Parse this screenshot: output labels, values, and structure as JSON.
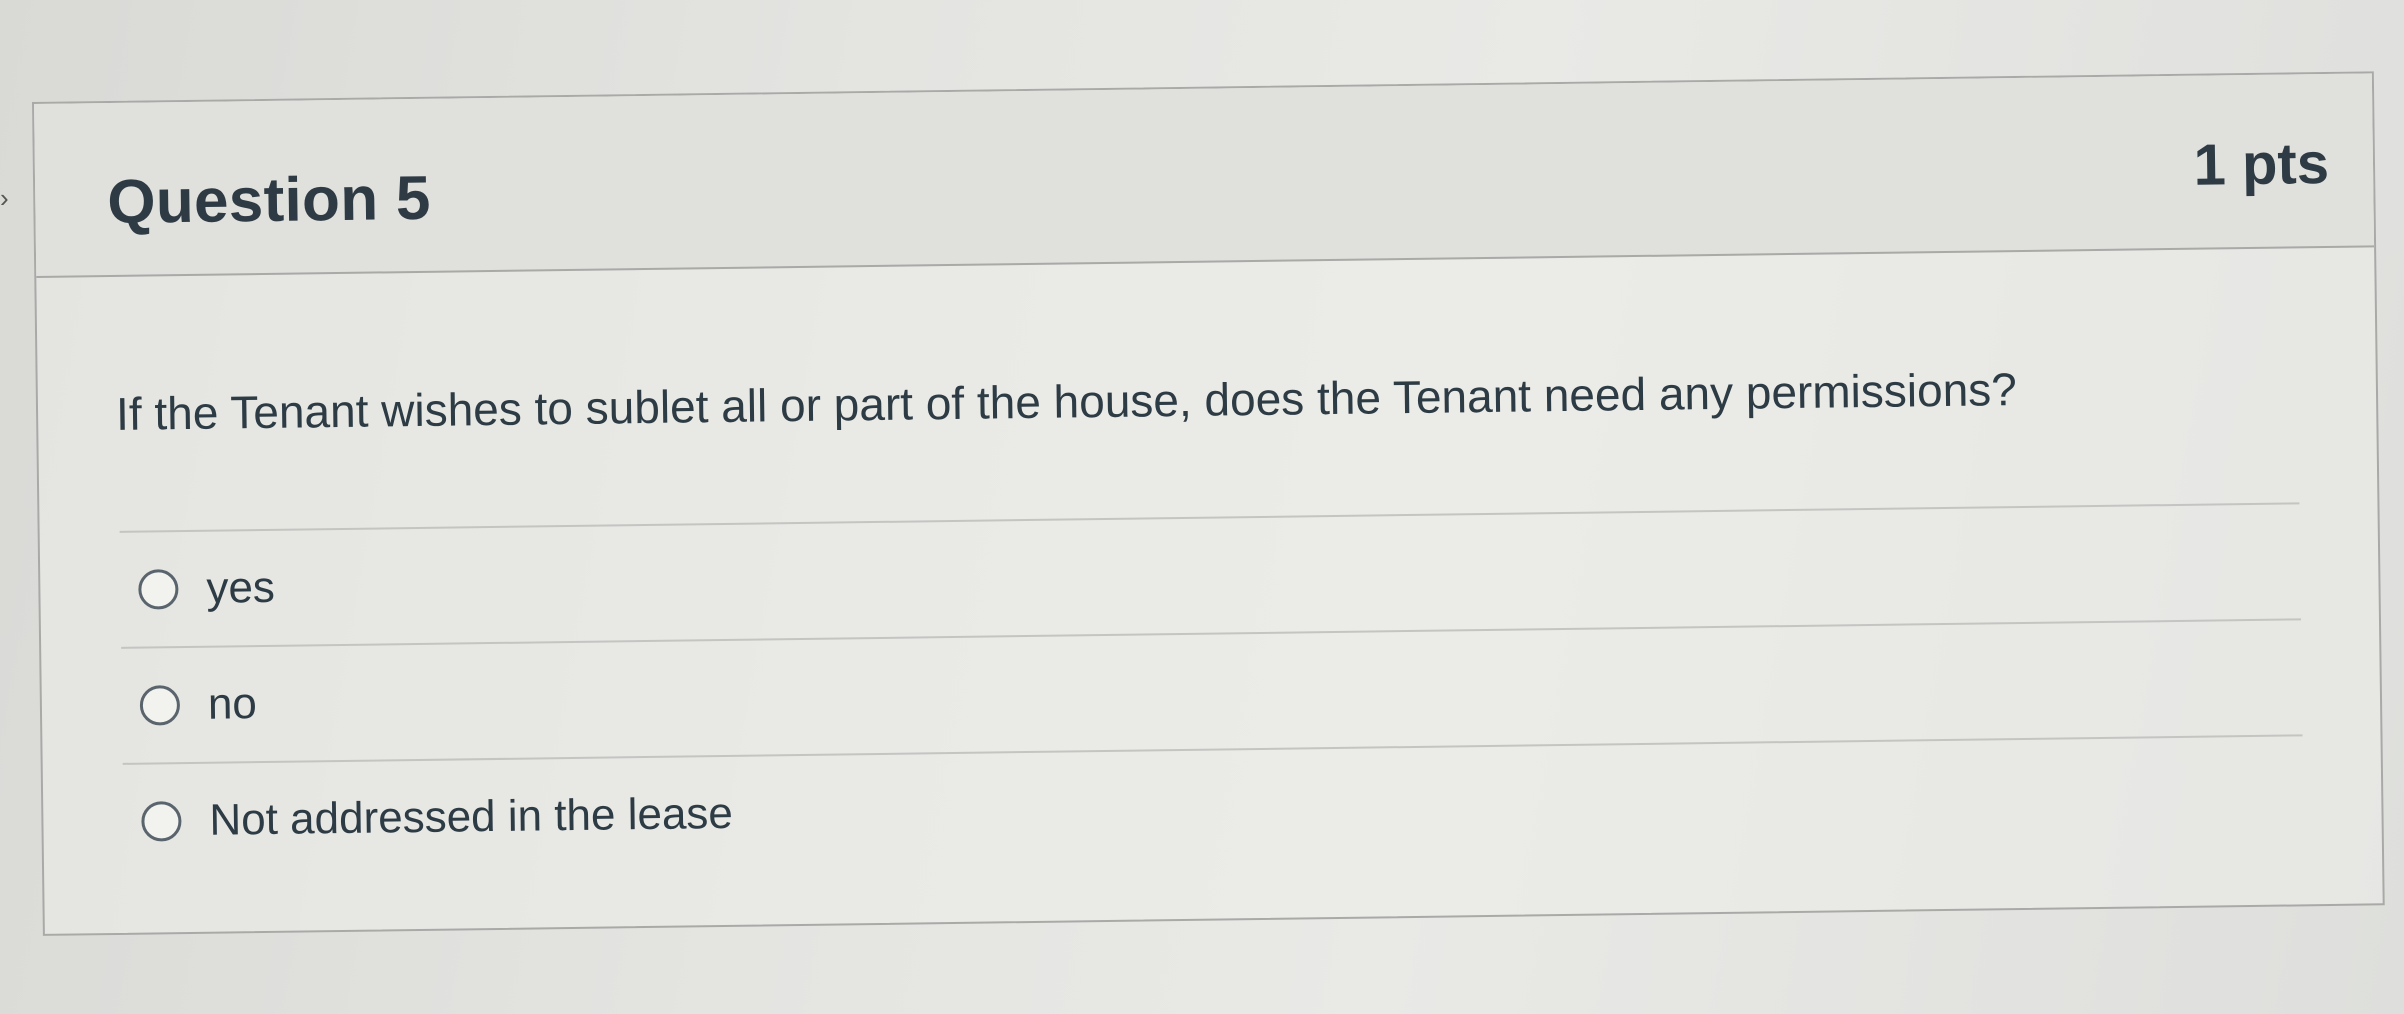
{
  "question": {
    "title": "Question 5",
    "points": "1 pts",
    "text": "If the Tenant wishes to sublet all or part of the house, does the Tenant need any permissions?"
  },
  "answers": [
    {
      "label": "yes",
      "selected": false
    },
    {
      "label": "no",
      "selected": false
    },
    {
      "label": "Not addressed in the lease",
      "selected": false
    }
  ],
  "nav": {
    "left_arrow_icon": "chevron-right-icon"
  }
}
